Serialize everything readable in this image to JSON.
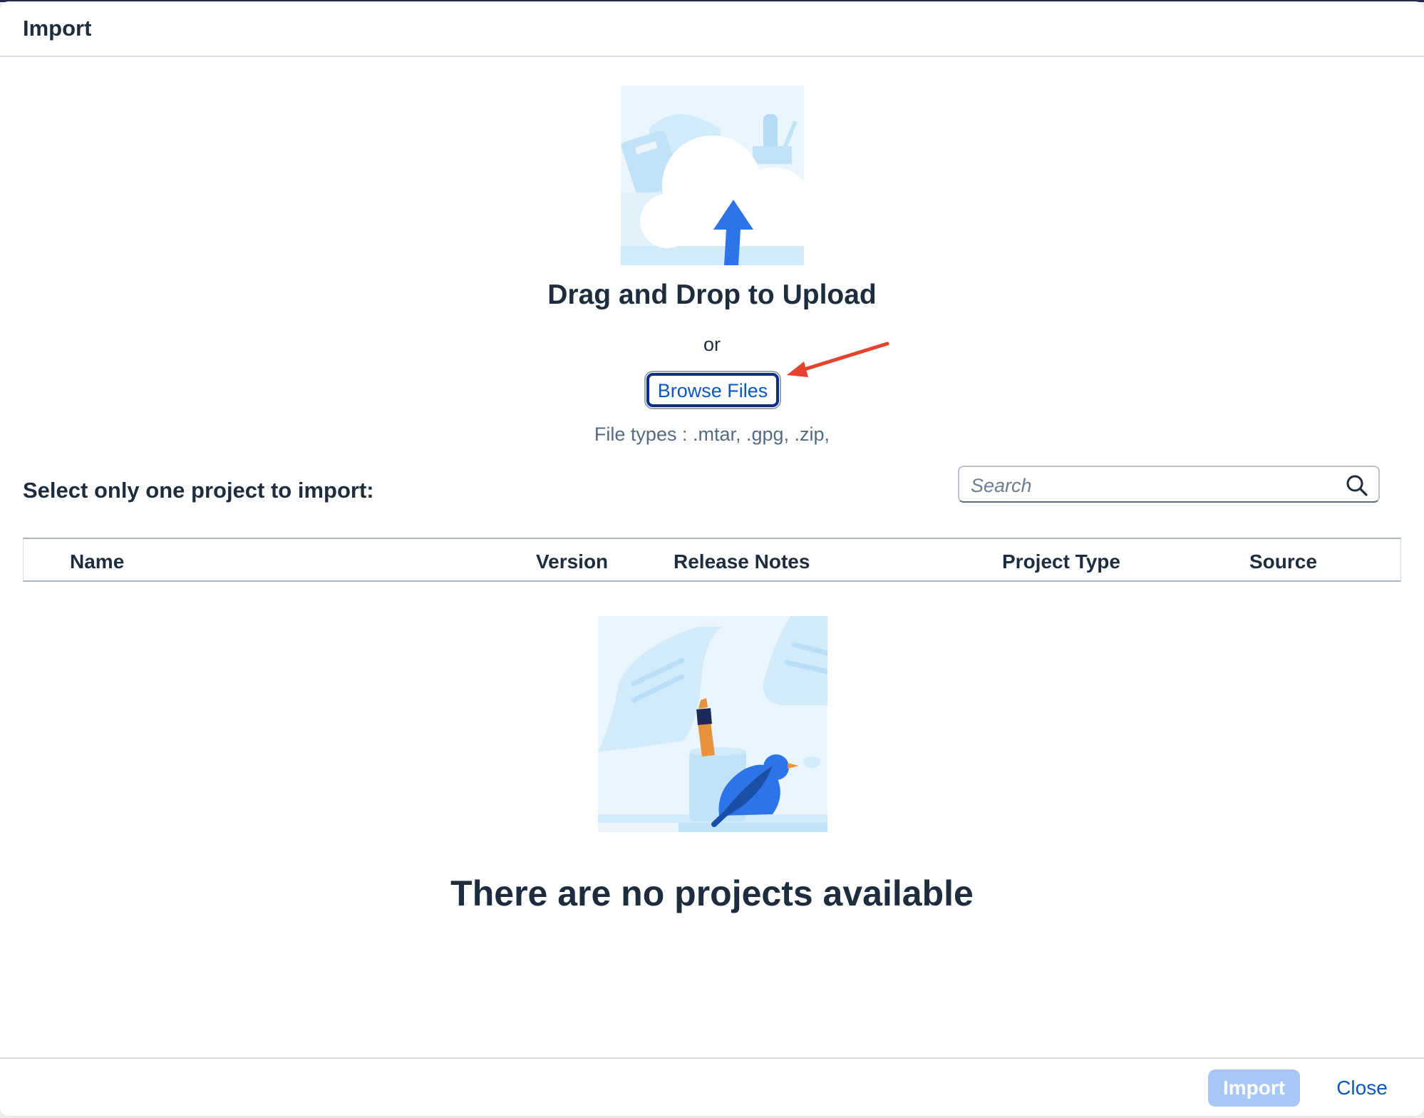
{
  "dialog": {
    "title": "Import"
  },
  "upload": {
    "illustration": "cloud-upload-illustration",
    "title": "Drag and Drop to Upload",
    "or_text": "or",
    "browse_label": "Browse Files",
    "file_types": "File types : .mtar, .gpg, .zip,"
  },
  "projects": {
    "select_label": "Select only one project to import:",
    "search": {
      "placeholder": "Search",
      "icon": "search-icon"
    },
    "columns": [
      "Name",
      "Version",
      "Release Notes",
      "Project Type",
      "Source"
    ],
    "rows": [],
    "empty_text": "There are no projects available",
    "empty_illustration": "empty-list-illustration"
  },
  "footer": {
    "import_label": "Import",
    "close_label": "Close"
  },
  "colors": {
    "accent": "#0a57c2",
    "annotation_arrow": "#e5432d",
    "disabled_button": "#a8c7f5",
    "title_text": "#1d2d3e"
  }
}
